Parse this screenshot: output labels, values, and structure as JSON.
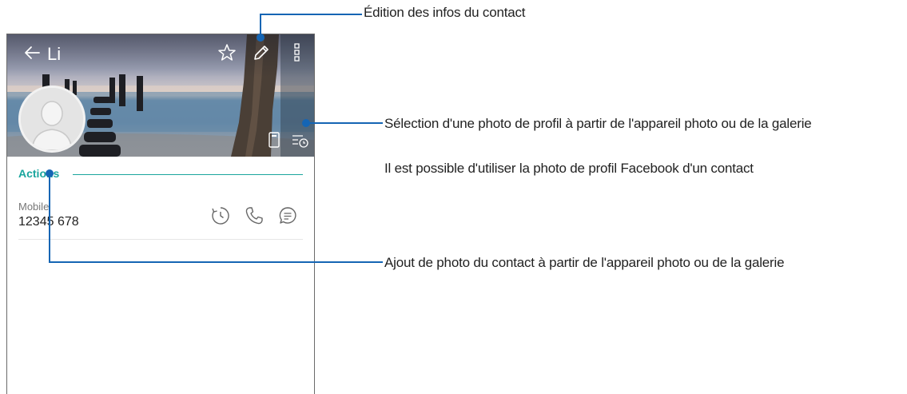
{
  "contact": {
    "name": "Li",
    "section_title": "Actions",
    "phone_type": "Mobile",
    "phone_number": "12345 678"
  },
  "colors": {
    "accent": "#1aa59d",
    "callout": "#1565b4"
  },
  "icons": {
    "back": "back-arrow-icon",
    "favorite": "star-icon",
    "edit": "pencil-icon",
    "menu": "more-vert-icon",
    "sim": "sim-card-icon",
    "history": "call-history-icon",
    "call_log": "clock-icon",
    "call": "phone-icon",
    "message": "message-icon"
  },
  "callouts": {
    "edit": "Édition des infos du contact",
    "profile_photo": "Sélection d'une photo de profil à partir de l'appareil photo ou de la galerie",
    "facebook": "Il est possible d'utiliser la photo de profil Facebook d'un contact",
    "add_photo": "Ajout de photo du contact à partir de l'appareil photo ou de la galerie"
  }
}
